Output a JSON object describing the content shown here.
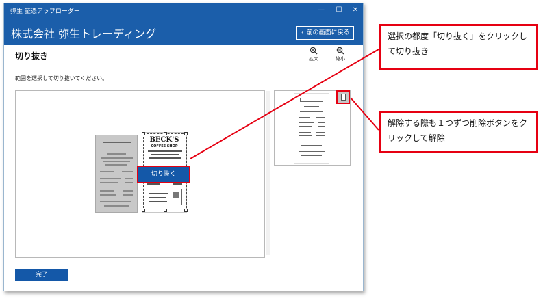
{
  "window": {
    "app_title": "弥生 証憑アップローダー",
    "controls": {
      "minimize": "—",
      "maximize": "☐",
      "close": "✕"
    }
  },
  "header": {
    "company": "株式会社 弥生トレーディング",
    "back_label": "前の画面に戻る"
  },
  "page": {
    "title": "切り抜き",
    "zoom_in_label": "拡大",
    "zoom_out_label": "縮小",
    "instruction": "範囲を選択して切り抜いてください。"
  },
  "receipt": {
    "shop_name": "BECK'S",
    "shop_sub": "COFFEE SHOP"
  },
  "actions": {
    "crop_label": "切り抜く",
    "done_label": "完了"
  },
  "callouts": {
    "crop": "選択の都度「切り抜く」をクリックして切り抜き",
    "delete": "解除する際も１つずつ削除ボタンをクリックして解除"
  },
  "colors": {
    "brand_blue": "#1b5eaa",
    "button_blue": "#1458a8",
    "highlight_red": "#e60012"
  }
}
